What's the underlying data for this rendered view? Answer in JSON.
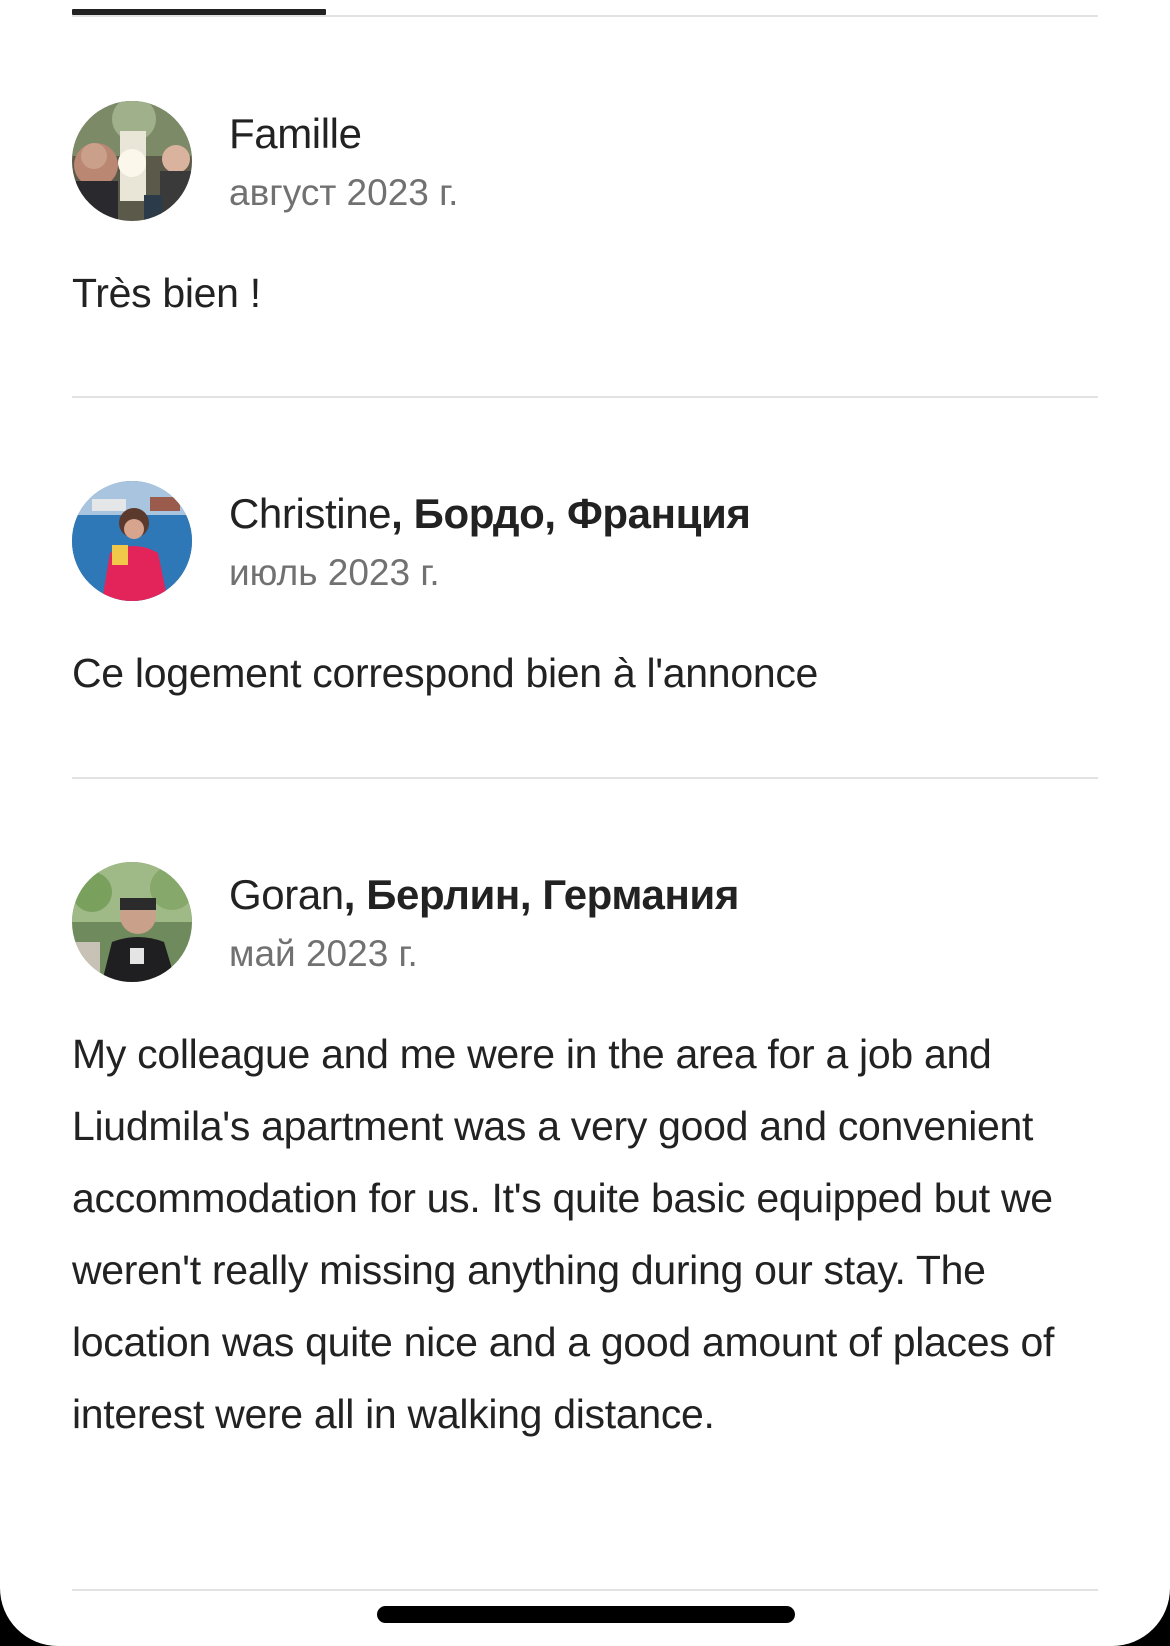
{
  "reviews": [
    {
      "name": "Famille",
      "location": "",
      "date": "август 2023 г.",
      "text": "Très bien !"
    },
    {
      "name": "Christine",
      "location": ", Бордо, Франция",
      "date": "июль 2023 г.",
      "text": "Ce logement correspond bien à l'annonce"
    },
    {
      "name": "Goran",
      "location": ", Берлин, Германия",
      "date": "май 2023 г.",
      "text": "My colleague and me were in the area for a job and Liudmila's apartment was  a very good and convenient accommodation for us. It's quite basic equipped but we weren't really missing anything during our stay. The location was quite nice and a good amount of places of interest were all in walking distance."
    }
  ],
  "colors": {
    "text_primary": "#222222",
    "text_secondary": "#717171",
    "divider": "#e2e2e2",
    "background": "#ffffff"
  },
  "icons": {
    "avatars": [
      "avatar-famille",
      "avatar-christine",
      "avatar-goran"
    ]
  }
}
